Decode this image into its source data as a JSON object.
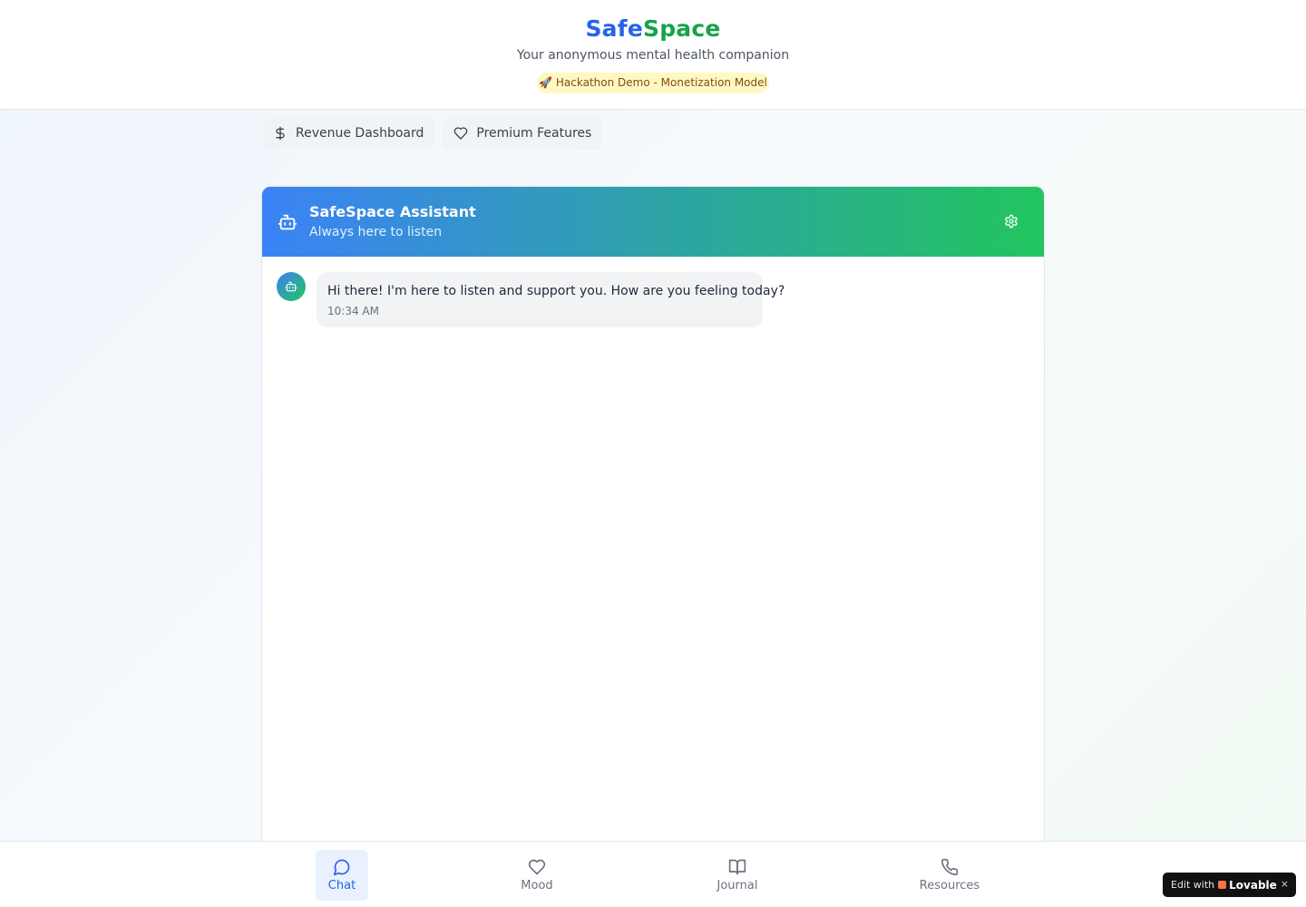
{
  "header": {
    "brand_part1": "Safe",
    "brand_part2": "Space",
    "tagline": "Your anonymous mental health companion",
    "badge": "🚀 Hackathon Demo - Monetization Model"
  },
  "toolbar": {
    "revenue_label": "Revenue Dashboard",
    "premium_label": "Premium Features"
  },
  "chat": {
    "assistant_name": "SafeSpace Assistant",
    "assistant_status": "Always here to listen",
    "messages": [
      {
        "text": "Hi there! I'm here to listen and support you. How are you feeling today?",
        "time": "10:34 AM"
      }
    ]
  },
  "bottom_nav": {
    "items": [
      {
        "label": "Chat",
        "icon": "message-circle-icon",
        "active": true
      },
      {
        "label": "Mood",
        "icon": "heart-icon",
        "active": false
      },
      {
        "label": "Journal",
        "icon": "book-open-icon",
        "active": false
      },
      {
        "label": "Resources",
        "icon": "phone-icon",
        "active": false
      }
    ]
  },
  "lovable_badge": {
    "prefix": "Edit with",
    "brand": "Lovable",
    "close": "×"
  },
  "colors": {
    "brand_blue": "#2563eb",
    "brand_green": "#16a34a",
    "gradient_start": "#3b82f6",
    "gradient_end": "#22c55e"
  }
}
